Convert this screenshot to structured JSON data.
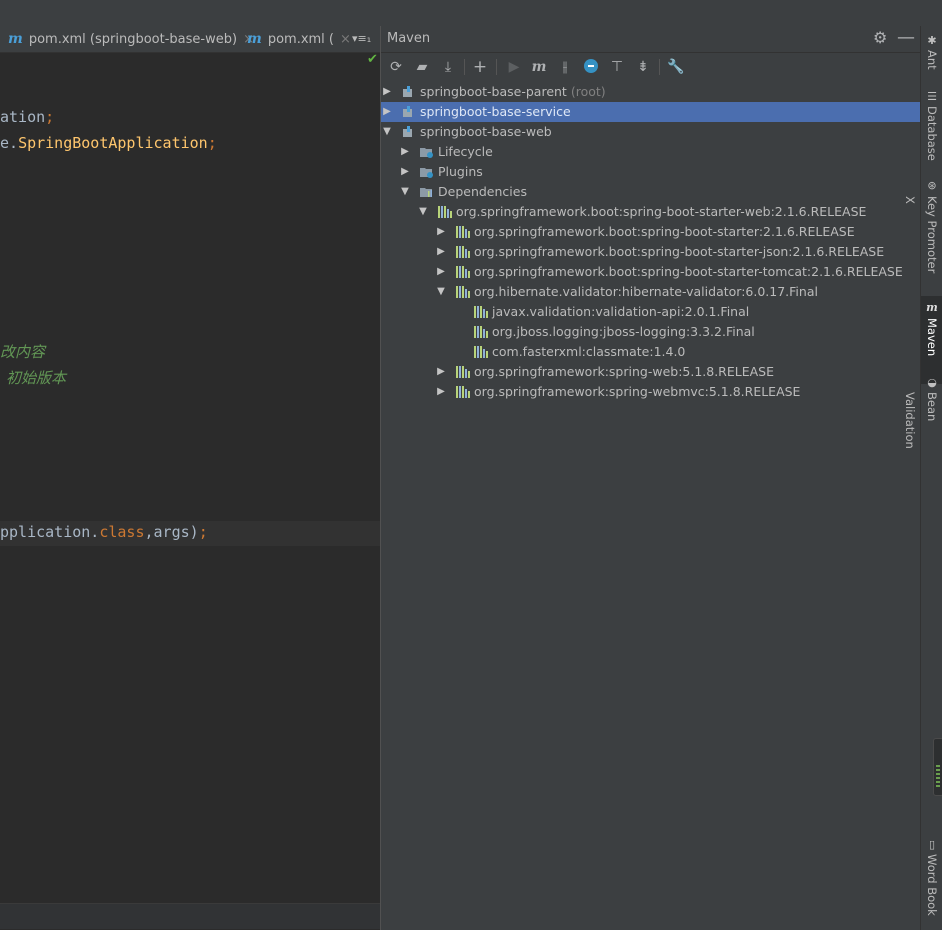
{
  "editor": {
    "tabs": [
      {
        "label": "pom.xml (springboot-base-web)",
        "close": "×"
      },
      {
        "label": "pom.xml (",
        "close": "×"
      }
    ],
    "tab_more": "▾≡₁",
    "code_lines": [
      {
        "plain": "ation",
        "semi": ";"
      },
      {
        "plain": "e.",
        "cls": "SpringBootApplication",
        "semi": ";"
      },
      {
        "comment": "改内容"
      },
      {
        "comment": "初始版本"
      },
      {
        "plain": "pplication.",
        "kw": "class",
        "plain2": ",args)",
        "semi": ";"
      }
    ]
  },
  "maven": {
    "title": "Maven",
    "tree": [
      {
        "label": "springboot-base-parent",
        "suffix": "(root)"
      },
      {
        "label": "springboot-base-service"
      },
      {
        "label": "springboot-base-web"
      },
      {
        "label": "Lifecycle"
      },
      {
        "label": "Plugins"
      },
      {
        "label": "Dependencies"
      },
      {
        "label": "org.springframework.boot:spring-boot-starter-web:2.1.6.RELEASE"
      },
      {
        "label": "org.springframework.boot:spring-boot-starter:2.1.6.RELEASE"
      },
      {
        "label": "org.springframework.boot:spring-boot-starter-json:2.1.6.RELEASE"
      },
      {
        "label": "org.springframework.boot:spring-boot-starter-tomcat:2.1.6.RELEASE"
      },
      {
        "label": "org.hibernate.validator:hibernate-validator:6.0.17.Final"
      },
      {
        "label": "javax.validation:validation-api:2.0.1.Final"
      },
      {
        "label": "org.jboss.logging:jboss-logging:3.3.2.Final"
      },
      {
        "label": "com.fasterxml:classmate:1.4.0"
      },
      {
        "label": "org.springframework:spring-web:5.1.8.RELEASE"
      },
      {
        "label": "org.springframework:spring-webmvc:5.1.8.RELEASE"
      }
    ],
    "toolbar_icons": [
      "refresh-icon",
      "generate-sources-icon",
      "download-icon",
      "add-icon",
      "run-icon",
      "maven-goal-icon",
      "toggle-offline-icon",
      "skip-tests-icon",
      "show-dependencies-icon",
      "collapse-all-icon",
      "settings-wrench-icon"
    ]
  },
  "stripe": {
    "ant": "Ant",
    "database": "Database",
    "key_promoter": "Key Promoter X",
    "maven": "Maven",
    "bean_validation": "Bean Validation",
    "word_book": "Word Book"
  },
  "colors": {
    "selection": "#4b6eaf",
    "panel_bg": "#3c3f41",
    "editor_bg": "#2b2b2b",
    "keyword": "#cc7832",
    "class_name": "#ffc66d",
    "comment": "#629755"
  }
}
